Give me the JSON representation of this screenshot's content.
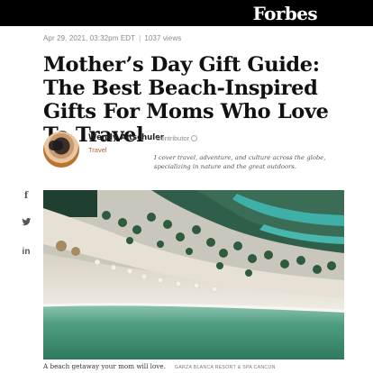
{
  "header": {
    "logo": "Forbes"
  },
  "article": {
    "date": "Apr 29, 2021, 03:32pm EDT",
    "views": "1037 views",
    "headline": "Mother’s Day Gift Guide: The Best Beach-Inspired Gifts For Moms Who Love To Travel",
    "author": {
      "name": "Wendy Altschuler",
      "role": "Contributor",
      "channel": "Travel",
      "bio": "I cover travel, adventure, and culture across the globe, specializing in nature and the great outdoors."
    },
    "image": {
      "caption": "A beach getaway your mom will love.",
      "credit": "GARZA BLANCA RESORT & SPA CANCUN"
    }
  },
  "share": {
    "facebook_icon": "f",
    "twitter_icon": "𝕥",
    "linkedin_icon": "in"
  },
  "colors": {
    "topbar": "#000000",
    "channel": "#c05a2e",
    "sea": "#3f8e72",
    "sand": "#ece8df"
  }
}
